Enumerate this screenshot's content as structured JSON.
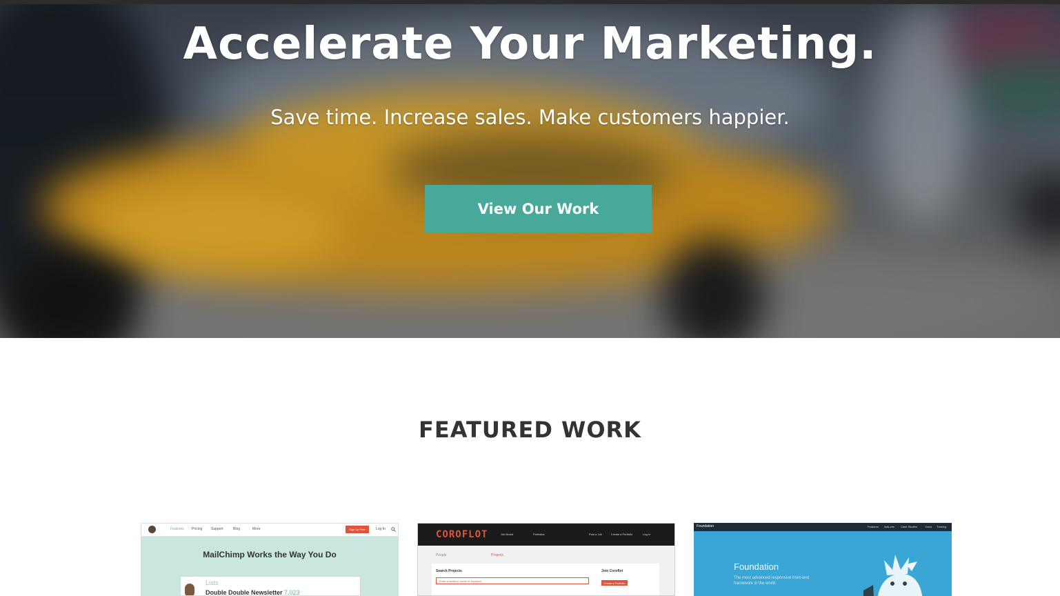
{
  "hero": {
    "title": "Accelerate Your Marketing.",
    "subtitle": "Save time. Increase sales. Make customers happier.",
    "cta_label": "View Our Work"
  },
  "featured": {
    "title": "FEATURED WORK",
    "cards": [
      {
        "nav": [
          "Features",
          "Pricing",
          "Support",
          "Blog",
          "More"
        ],
        "signup": "Sign Up Free",
        "login": "Log In",
        "headline": "MailChimp Works the Way You Do",
        "lists_label": "Lists",
        "newsletter": "Double Double Newsletter",
        "count": "7,023"
      },
      {
        "logo": "COROFLOT",
        "nav": [
          "Job Board",
          "Portfolios",
          "Post a Job",
          "Create a Portfolio",
          "Log in"
        ],
        "tab_people": "People",
        "tab_projects": "Projects",
        "search_label": "Search Projects",
        "search_placeholder": "Enter a location, name or keyword",
        "join_label": "Join Coroflot",
        "join_button": "Create a Portfolio"
      },
      {
        "brand": "Foundation",
        "nav": [
          "Features",
          "Add-ons",
          "Case Studies",
          "Docs",
          "Training"
        ],
        "title": "Foundation",
        "desc": "The most advanced responsive front-end framework in the world."
      }
    ]
  },
  "colors": {
    "accent": "#48a89a",
    "heading": "#333333",
    "mailchimp_bg": "#c9e6df",
    "coroflot_red": "#e0533b",
    "foundation_blue": "#3aa6d6"
  },
  "icons": [
    "search-icon",
    "mailchimp-logo-icon",
    "foundation-mascot-icon"
  ]
}
